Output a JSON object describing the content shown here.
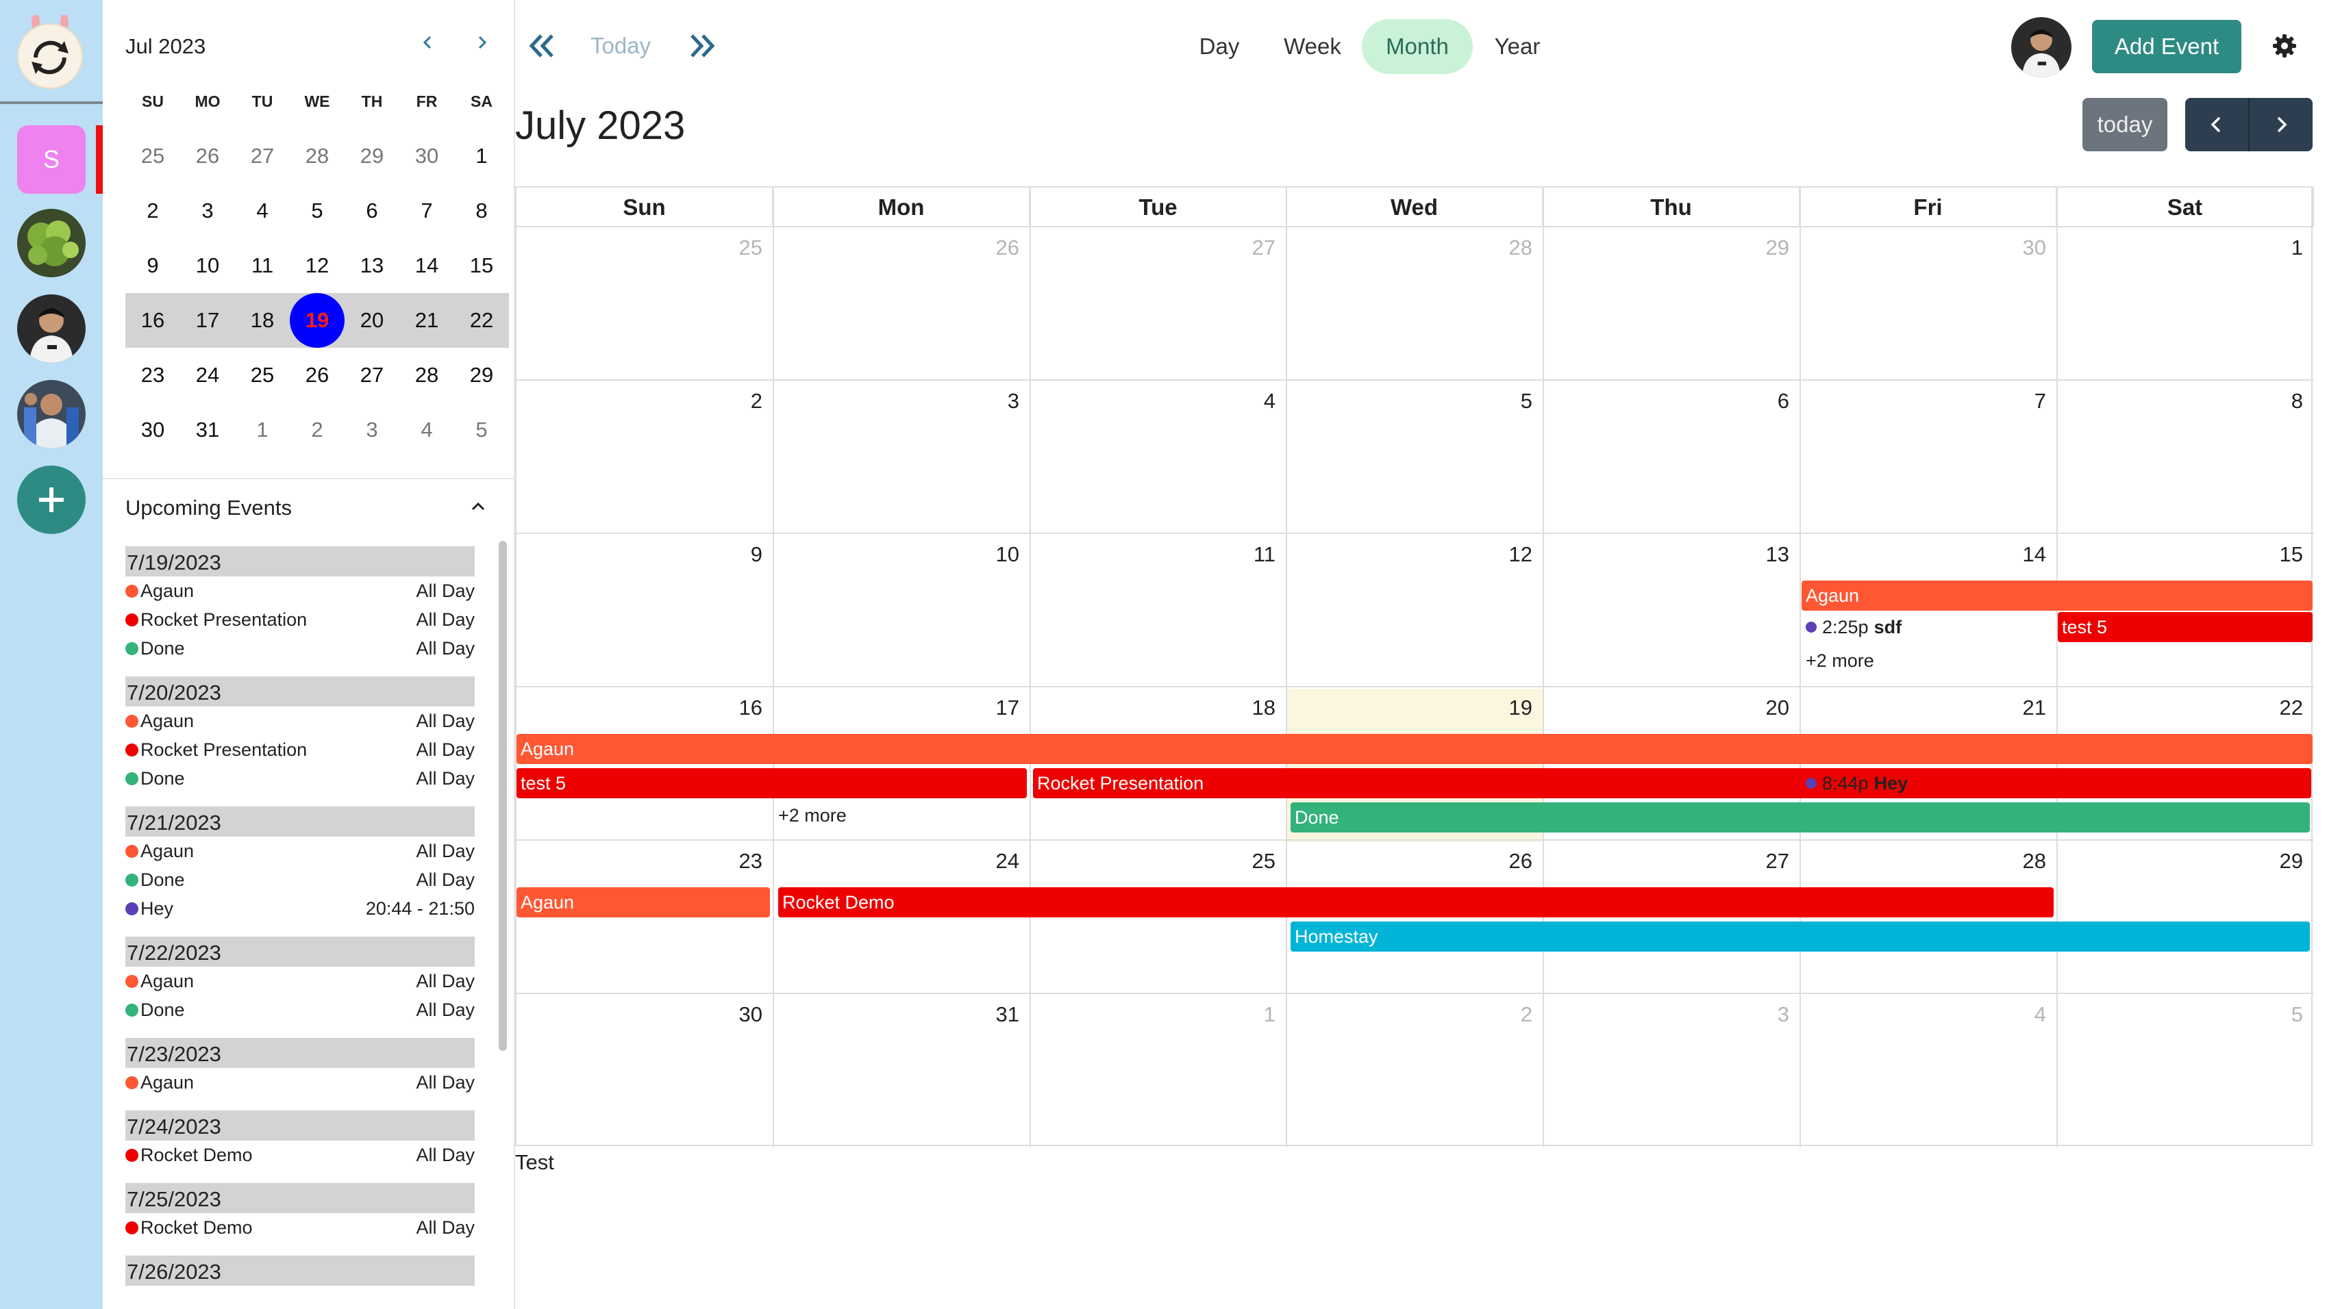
{
  "rail": {
    "space_initial": "S"
  },
  "mini_calendar": {
    "title": "Jul 2023",
    "prev_icon": "chevron-left-icon",
    "next_icon": "chevron-right-icon",
    "weekdays": [
      "SU",
      "MO",
      "TU",
      "WE",
      "TH",
      "FR",
      "SA"
    ],
    "weeks": [
      [
        "25",
        "26",
        "27",
        "28",
        "29",
        "30",
        "1"
      ],
      [
        "2",
        "3",
        "4",
        "5",
        "6",
        "7",
        "8"
      ],
      [
        "9",
        "10",
        "11",
        "12",
        "13",
        "14",
        "15"
      ],
      [
        "16",
        "17",
        "18",
        "19",
        "20",
        "21",
        "22"
      ],
      [
        "23",
        "24",
        "25",
        "26",
        "27",
        "28",
        "29"
      ],
      [
        "30",
        "31",
        "1",
        "2",
        "3",
        "4",
        "5"
      ]
    ],
    "selected": "19"
  },
  "upcoming": {
    "title": "Upcoming Events",
    "groups": [
      {
        "date": "7/19/2023",
        "events": [
          {
            "name": "Agaun",
            "time": "All Day",
            "color": "#ff5733"
          },
          {
            "name": "Rocket Presentation",
            "time": "All Day",
            "color": "#ee0000"
          },
          {
            "name": "Done",
            "time": "All Day",
            "color": "#33b27a"
          }
        ]
      },
      {
        "date": "7/20/2023",
        "events": [
          {
            "name": "Agaun",
            "time": "All Day",
            "color": "#ff5733"
          },
          {
            "name": "Rocket Presentation",
            "time": "All Day",
            "color": "#ee0000"
          },
          {
            "name": "Done",
            "time": "All Day",
            "color": "#33b27a"
          }
        ]
      },
      {
        "date": "7/21/2023",
        "events": [
          {
            "name": "Agaun",
            "time": "All Day",
            "color": "#ff5733"
          },
          {
            "name": "Done",
            "time": "All Day",
            "color": "#33b27a"
          },
          {
            "name": "Hey",
            "time": "20:44 - 21:50",
            "color": "#5b3fb5"
          }
        ]
      },
      {
        "date": "7/22/2023",
        "events": [
          {
            "name": "Agaun",
            "time": "All Day",
            "color": "#ff5733"
          },
          {
            "name": "Done",
            "time": "All Day",
            "color": "#33b27a"
          }
        ]
      },
      {
        "date": "7/23/2023",
        "events": [
          {
            "name": "Agaun",
            "time": "All Day",
            "color": "#ff5733"
          }
        ]
      },
      {
        "date": "7/24/2023",
        "events": [
          {
            "name": "Rocket Demo",
            "time": "All Day",
            "color": "#ee0000"
          }
        ]
      },
      {
        "date": "7/25/2023",
        "events": [
          {
            "name": "Rocket Demo",
            "time": "All Day",
            "color": "#ee0000"
          }
        ]
      },
      {
        "date": "7/26/2023",
        "events": []
      }
    ]
  },
  "toolbar": {
    "today_label": "Today",
    "views": [
      "Day",
      "Week",
      "Month",
      "Year"
    ],
    "active_view": "Month",
    "add_event_label": "Add Event",
    "accent_color": "#2e8b84"
  },
  "calendar": {
    "title": "July 2023",
    "today_button": "today",
    "weekday_headers": [
      "Sun",
      "Mon",
      "Tue",
      "Wed",
      "Thu",
      "Fri",
      "Sat"
    ],
    "weeks": [
      [
        "25",
        "26",
        "27",
        "28",
        "29",
        "30",
        "1"
      ],
      [
        "2",
        "3",
        "4",
        "5",
        "6",
        "7",
        "8"
      ],
      [
        "9",
        "10",
        "11",
        "12",
        "13",
        "14",
        "15"
      ],
      [
        "16",
        "17",
        "18",
        "19",
        "20",
        "21",
        "22"
      ],
      [
        "23",
        "24",
        "25",
        "26",
        "27",
        "28",
        "29"
      ],
      [
        "30",
        "31",
        "1",
        "2",
        "3",
        "4",
        "5"
      ]
    ],
    "today_date": "19",
    "events": {
      "agaun": "Agaun",
      "sdf_time": "2:25p",
      "sdf_title": "sdf",
      "test5": "test 5",
      "rocket_presentation": "Rocket Presentation",
      "hey_time": "8:44p",
      "hey_title": "Hey",
      "done": "Done",
      "rocket_demo": "Rocket Demo",
      "homestay": "Homestay",
      "more_label": "+2 more"
    },
    "colors": {
      "agaun": "#ff5733",
      "red": "#ee0000",
      "done": "#33b27a",
      "homestay": "#00b4d8",
      "today_bg": "#fdf6df"
    }
  },
  "footer": {
    "text": "Test"
  }
}
